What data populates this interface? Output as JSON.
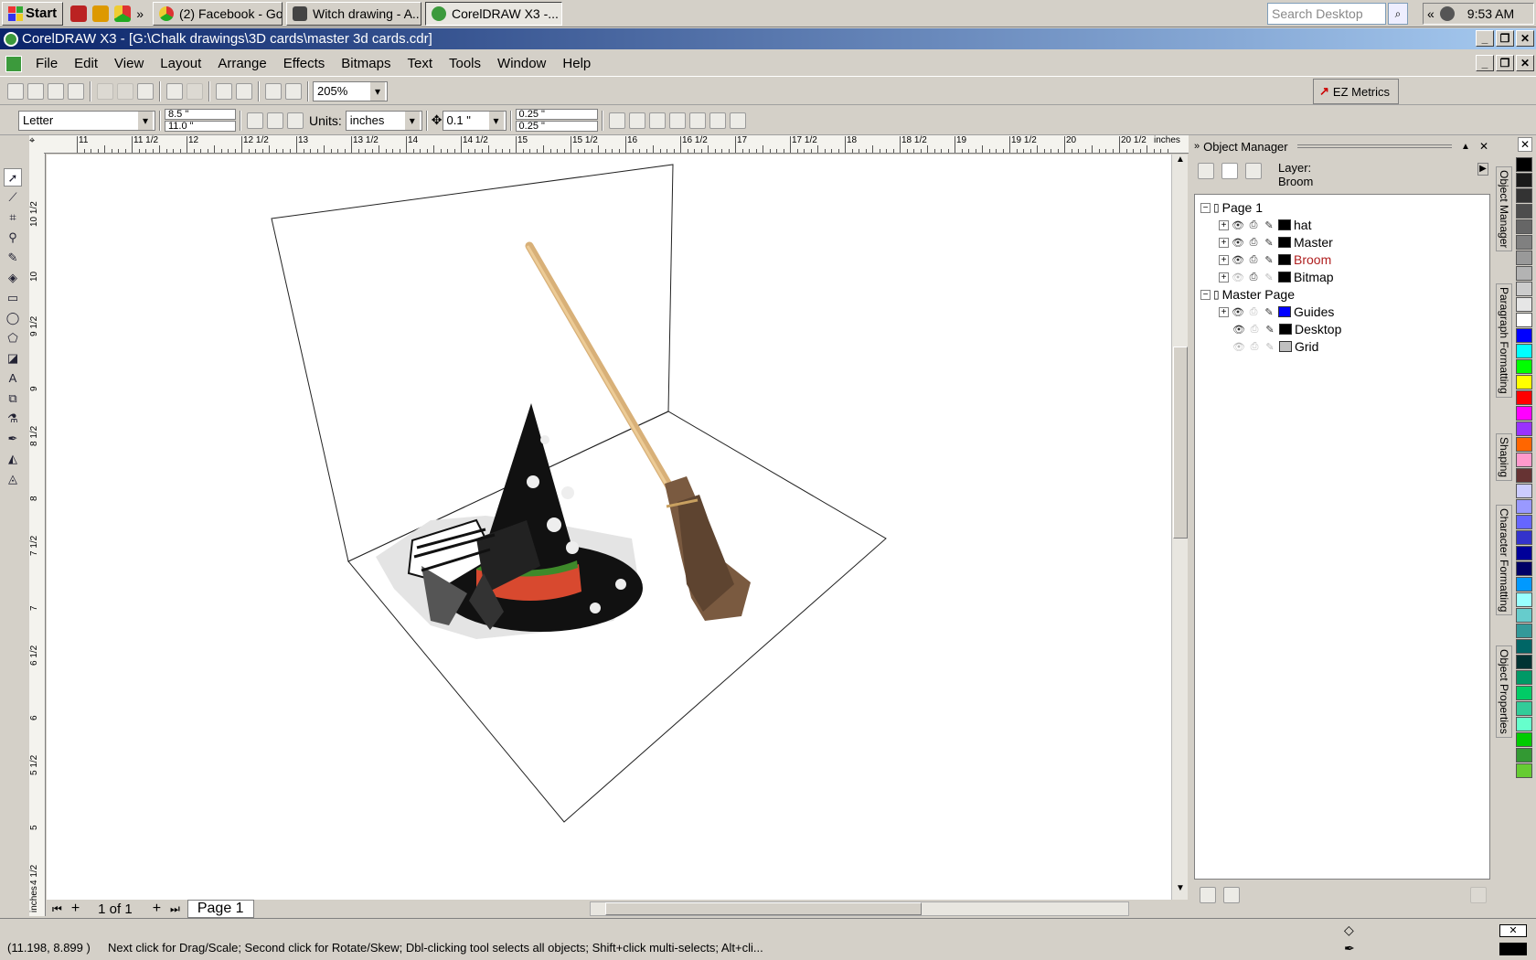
{
  "taskbar": {
    "start_label": "Start",
    "tasks": [
      {
        "label": "(2) Facebook - Go...",
        "icon": "chrome-icon"
      },
      {
        "label": "Witch drawing - A...",
        "icon": "camera-icon"
      },
      {
        "label": "CorelDRAW X3 -...",
        "icon": "coreldraw-icon"
      }
    ],
    "overflow": "»",
    "search_placeholder": "Search Desktop",
    "tray_chevron": "«",
    "clock": "9:53 AM"
  },
  "window": {
    "title": "CorelDRAW X3 - [G:\\Chalk drawings\\3D cards\\master 3d cards.cdr]"
  },
  "menu": [
    "File",
    "Edit",
    "View",
    "Layout",
    "Arrange",
    "Effects",
    "Bitmaps",
    "Text",
    "Tools",
    "Window",
    "Help"
  ],
  "toolbar": {
    "zoom": "205%",
    "ez_metrics": "EZ Metrics"
  },
  "property_bar": {
    "paper": "Letter",
    "width": "8.5 \"",
    "height": "11.0 \"",
    "units_label": "Units:",
    "units": "inches",
    "nudge": "0.1 \"",
    "dup_x": "0.25 \"",
    "dup_y": "0.25 \""
  },
  "rulers": {
    "horizontal": [
      "11",
      "11 1/2",
      "12",
      "12 1/2",
      "13",
      "13 1/2",
      "14",
      "14 1/2",
      "15",
      "15 1/2",
      "16",
      "16 1/2",
      "17",
      "17 1/2",
      "18",
      "18 1/2",
      "19",
      "19 1/2",
      "20",
      "20 1/2",
      "inches"
    ],
    "vertical": [
      "10 1/2",
      "10",
      "9 1/2",
      "9",
      "8 1/2",
      "8",
      "7 1/2",
      "7",
      "6 1/2",
      "6",
      "5 1/2",
      "5",
      "4 1/2",
      "inches"
    ]
  },
  "page_nav": {
    "counter": "1 of 1",
    "tab": "Page 1"
  },
  "object_manager": {
    "title": "Object Manager",
    "layer_label": "Layer:",
    "layer_value": "Broom",
    "page1": "Page 1",
    "layers": [
      {
        "name": "hat",
        "color": "#000000",
        "active": false
      },
      {
        "name": "Master",
        "color": "#000000",
        "active": false
      },
      {
        "name": "Broom",
        "color": "#000000",
        "active": true
      },
      {
        "name": "Bitmap",
        "color": "#000000",
        "active": false
      }
    ],
    "master_page": "Master Page",
    "master_layers": [
      {
        "name": "Guides",
        "color": "#0000ff"
      },
      {
        "name": "Desktop",
        "color": "#000000"
      },
      {
        "name": "Grid",
        "color": "#c0c0c0"
      }
    ]
  },
  "dock_tabs": [
    "Object Manager",
    "Paragraph Formatting",
    "Shaping",
    "Character Formatting",
    "Object Properties"
  ],
  "palette": [
    "#000000",
    "#1a1a1a",
    "#333333",
    "#4d4d4d",
    "#666666",
    "#808080",
    "#999999",
    "#b3b3b3",
    "#cccccc",
    "#e6e6e6",
    "#ffffff",
    "#0000ff",
    "#00ffff",
    "#00ff00",
    "#ffff00",
    "#ff0000",
    "#ff00ff",
    "#9933ff",
    "#ff6600",
    "#ff99cc",
    "#663333",
    "#ccccff",
    "#9999ff",
    "#6666ff",
    "#3333cc",
    "#000099",
    "#000066",
    "#0099ff",
    "#99ffff",
    "#66cccc",
    "#339999",
    "#006666",
    "#003333",
    "#009966",
    "#00cc66",
    "#33cc99",
    "#66ffcc",
    "#00cc00",
    "#339933",
    "#66cc33"
  ],
  "status": {
    "coords": "(11.198, 8.899 )",
    "message": "Next click for Drag/Scale; Second click for Rotate/Skew; Dbl-clicking tool selects all objects; Shift+click multi-selects; Alt+cli..."
  }
}
